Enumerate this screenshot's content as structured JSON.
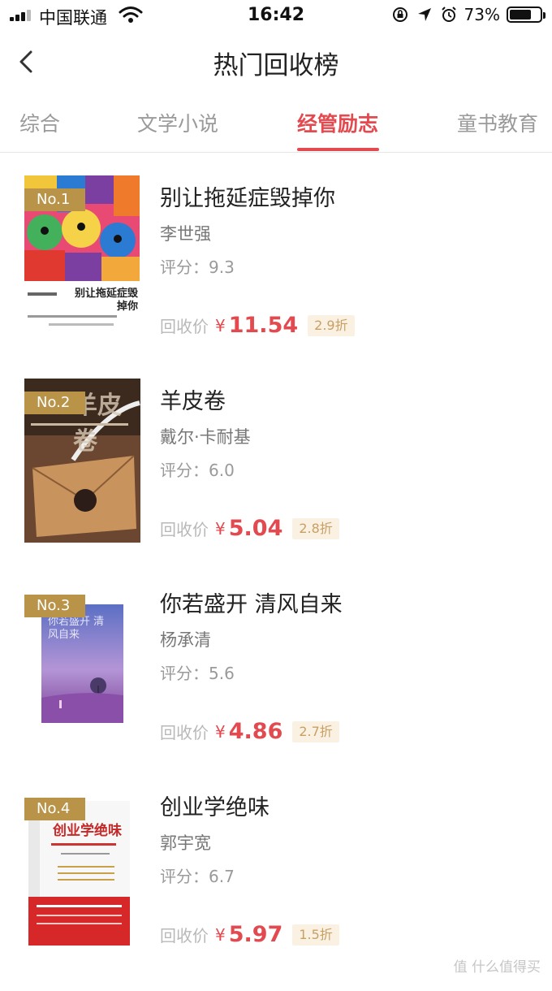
{
  "status_bar": {
    "carrier": "中国联通",
    "time": "16:42",
    "battery": "73%",
    "battery_level": 0.73
  },
  "nav": {
    "title": "热门回收榜"
  },
  "tabs": [
    {
      "label": "综合"
    },
    {
      "label": "文学小说"
    },
    {
      "label": "经管励志",
      "active": true
    },
    {
      "label": "童书教育"
    }
  ],
  "books": [
    {
      "rank": "No.1",
      "title": "别让拖延症毁掉你",
      "author": "李世强",
      "rating": "评分：9.3",
      "price_label": "回收价",
      "currency": "¥",
      "price": "11.54",
      "discount": "2.9折",
      "cover_text": "别让拖延症毁掉你"
    },
    {
      "rank": "No.2",
      "title": "羊皮卷",
      "author": "戴尔·卡耐基",
      "rating": "评分：6.0",
      "price_label": "回收价",
      "currency": "¥",
      "price": "5.04",
      "discount": "2.8折",
      "cover_text": "羊皮卷"
    },
    {
      "rank": "No.3",
      "title": "你若盛开 清风自来",
      "author": "杨承清",
      "rating": "评分：5.6",
      "price_label": "回收价",
      "currency": "¥",
      "price": "4.86",
      "discount": "2.7折",
      "cover_text": "你若盛开 清风自来"
    },
    {
      "rank": "No.4",
      "title": "创业学绝味",
      "author": "郭宇宽",
      "rating": "评分：6.7",
      "price_label": "回收价",
      "currency": "¥",
      "price": "5.97",
      "discount": "1.5折",
      "cover_text": "创业学绝味"
    }
  ],
  "watermark": "值 什么值得买",
  "colors": {
    "accent": "#e24a4f",
    "rank_badge": "#b89348",
    "discount_bg": "#fbf1e2"
  }
}
